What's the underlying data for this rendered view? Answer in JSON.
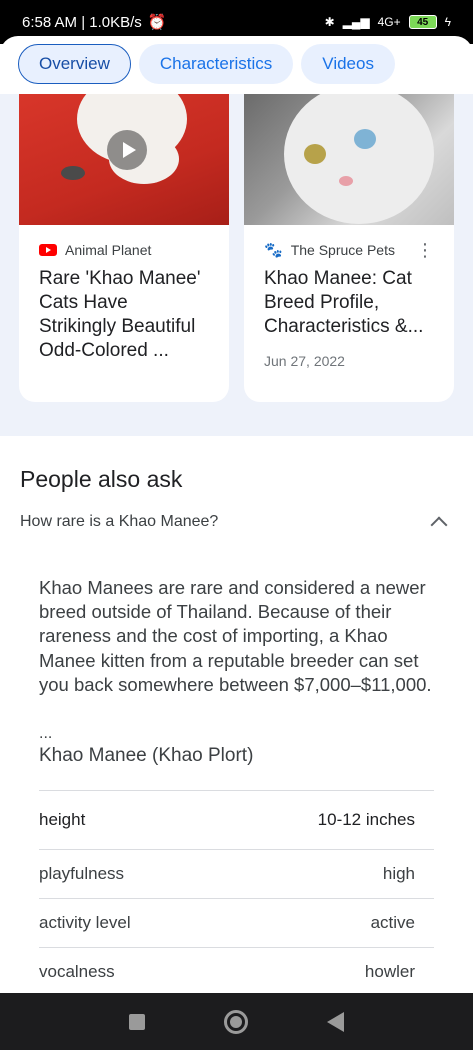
{
  "status_bar": {
    "time_speed": "6:58 AM | 1.0KB/s",
    "network": "4G+",
    "battery": "45"
  },
  "tabs": [
    {
      "label": "Overview",
      "active": true
    },
    {
      "label": "Characteristics",
      "active": false
    },
    {
      "label": "Videos",
      "active": false
    }
  ],
  "cards": [
    {
      "source": "Animal Planet",
      "source_icon": "youtube-icon",
      "title": "Rare 'Khao Manee' Cats Have Strikingly Beautiful Odd-Colored ...",
      "has_video": true
    },
    {
      "source": "The Spruce Pets",
      "source_icon": "paw-icon",
      "title": "Khao Manee: Cat Breed Profile, Characteristics &...",
      "date": "Jun 27, 2022"
    }
  ],
  "people_also_ask": {
    "heading": "People also ask",
    "question": "How rare is a Khao Manee?",
    "answer": "Khao Manees are rare and considered a newer breed outside of Thailand. Because of their rareness and the cost of importing, a Khao Manee kitten from a reputable breeder can set you back somewhere between $7,000–$11,000.",
    "ellipsis": "...",
    "answer_source": "Khao Manee (Khao Plort)",
    "facts": [
      {
        "key": "height",
        "value": "10-12 inches"
      },
      {
        "key": "playfulness",
        "value": "high"
      },
      {
        "key": "activity level",
        "value": "active"
      },
      {
        "key": "vocalness",
        "value": "howler"
      }
    ]
  },
  "colors": {
    "accent": "#1a73e8",
    "tab_bg": "#e8f0fe",
    "news_band": "#eef2fa"
  }
}
